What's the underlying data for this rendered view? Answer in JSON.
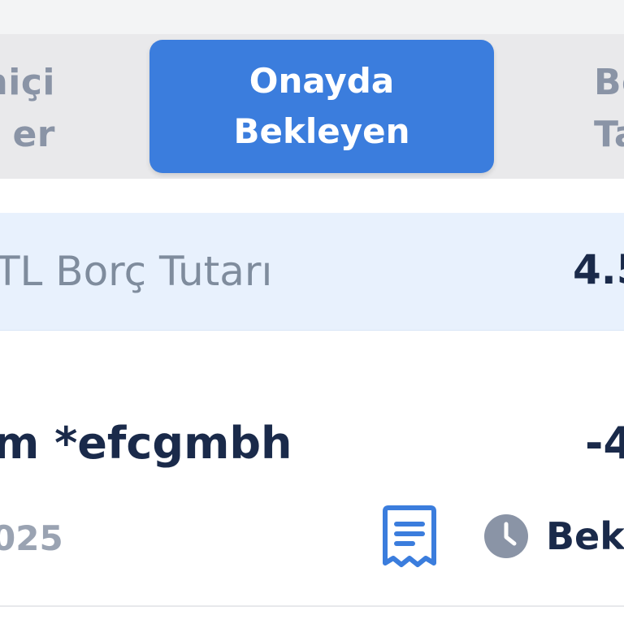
{
  "tabs": {
    "left": {
      "line1": "niçi",
      "line2": "er"
    },
    "active": {
      "line1": "Onayda",
      "line2": "Bekleyen"
    },
    "right": {
      "line1": "Bo",
      "line2": "Ta"
    }
  },
  "summary": {
    "label": "TL Borç Tutarı",
    "value": "4.5"
  },
  "transaction": {
    "merchant": "m *efcgmbh",
    "amount": "-4",
    "date": "025",
    "status": "Bek"
  },
  "colors": {
    "accent": "#3b7ddd",
    "summary_bg": "#e8f1fd",
    "text_dark": "#1a2a4a",
    "text_muted": "#9aa3b2"
  },
  "icons": {
    "receipt": "receipt-icon",
    "clock": "clock-icon"
  }
}
